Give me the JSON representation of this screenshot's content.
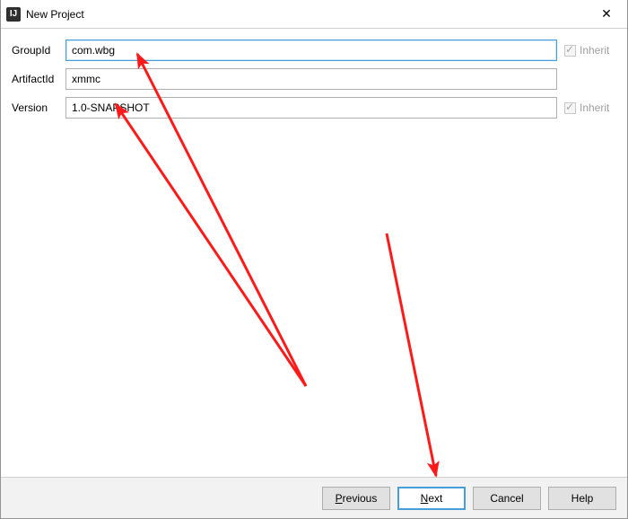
{
  "window": {
    "title": "New Project",
    "icon_label": "IJ"
  },
  "fields": {
    "groupId": {
      "label": "GroupId",
      "value": "com.wbg",
      "inherit_label": "Inherit"
    },
    "artifactId": {
      "label": "ArtifactId",
      "value": "xmmc"
    },
    "version": {
      "label": "Version",
      "value": "1.0-SNAPSHOT",
      "inherit_label": "Inherit"
    }
  },
  "buttons": {
    "previous": "Previous",
    "next": "Next",
    "cancel": "Cancel",
    "help": "Help"
  },
  "annotations": {
    "color": "#ff1a1a"
  }
}
